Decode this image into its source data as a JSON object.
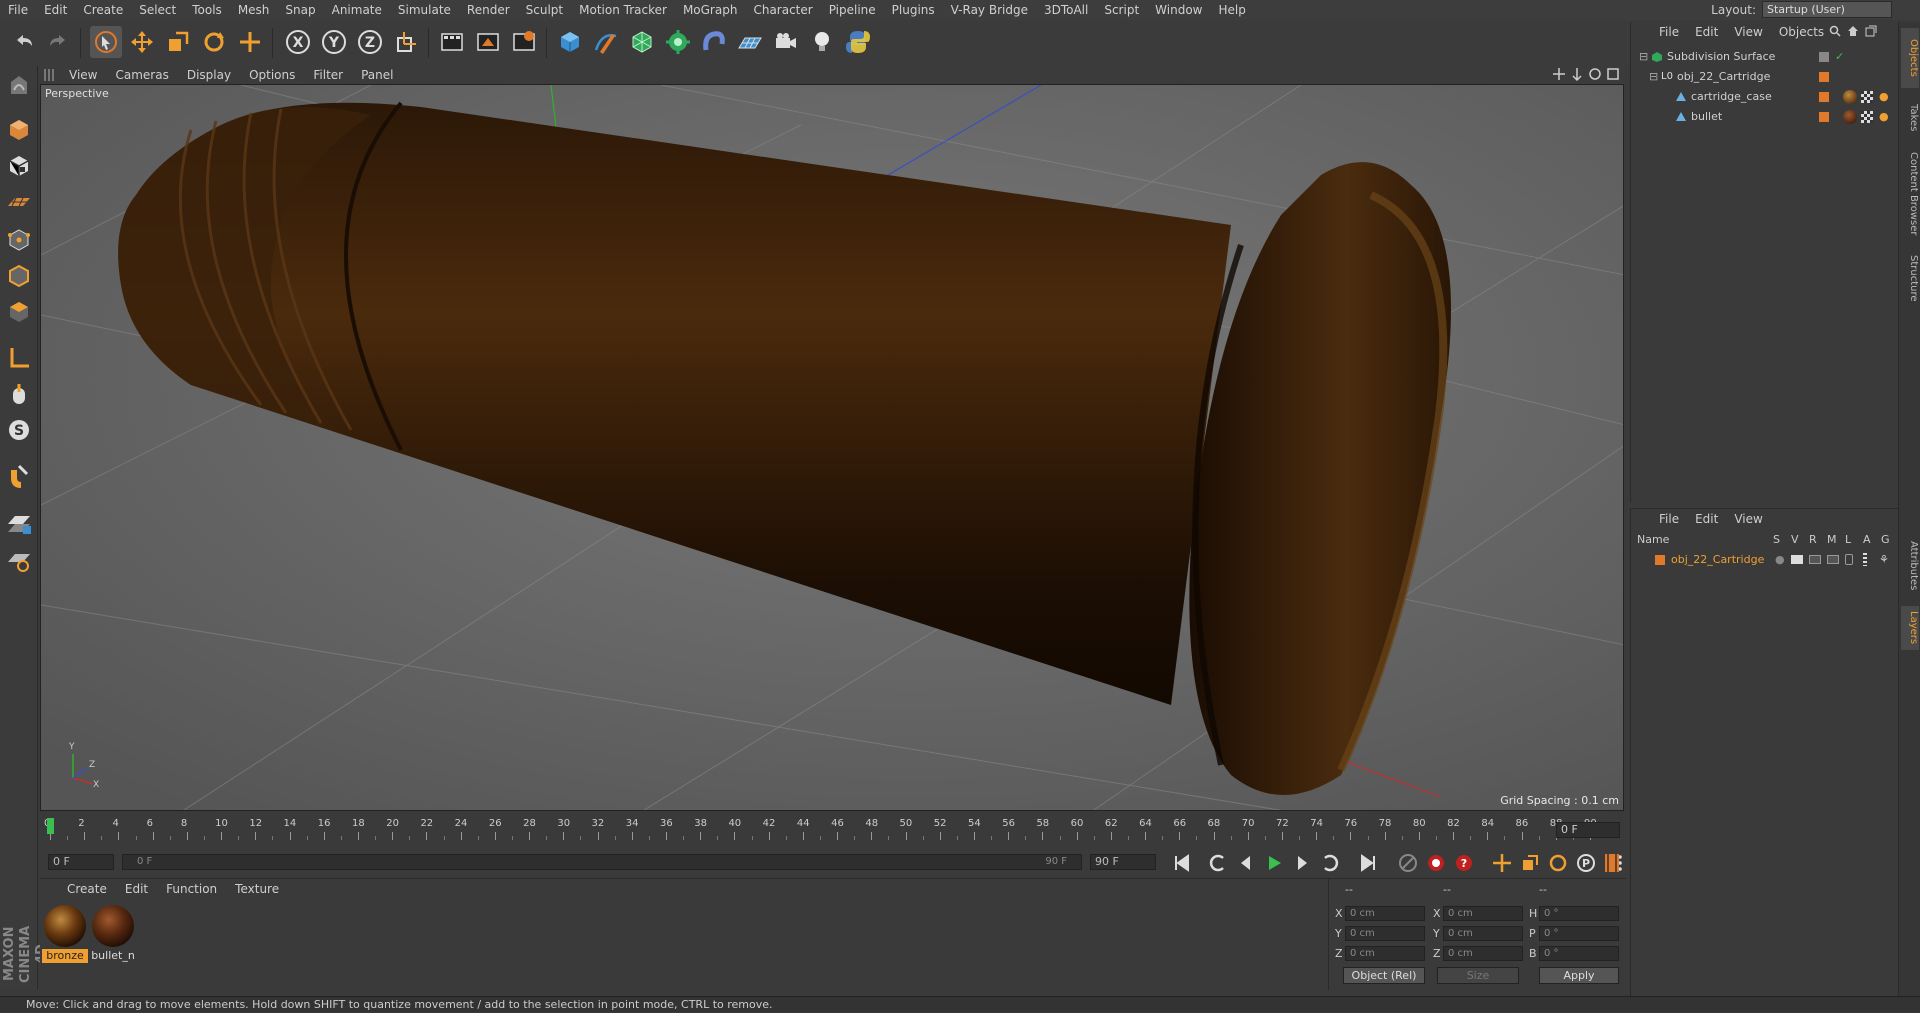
{
  "menu": [
    "File",
    "Edit",
    "Create",
    "Select",
    "Tools",
    "Mesh",
    "Snap",
    "Animate",
    "Simulate",
    "Render",
    "Sculpt",
    "Motion Tracker",
    "MoGraph",
    "Character",
    "Pipeline",
    "Plugins",
    "V-Ray Bridge",
    "3DToAll",
    "Script",
    "Window",
    "Help"
  ],
  "layout": {
    "label": "Layout:",
    "value": "Startup (User)"
  },
  "viewport": {
    "menu": [
      "View",
      "Cameras",
      "Display",
      "Options",
      "Filter",
      "Panel"
    ],
    "camera_label": "Perspective",
    "grid_spacing": "Grid Spacing : 0.1 cm",
    "axis": {
      "x": "X",
      "y": "Y",
      "z": "Z"
    }
  },
  "timeline": {
    "ticks": [
      "0",
      "2",
      "4",
      "6",
      "8",
      "10",
      "12",
      "14",
      "16",
      "18",
      "20",
      "22",
      "24",
      "26",
      "28",
      "30",
      "32",
      "34",
      "36",
      "38",
      "40",
      "42",
      "44",
      "46",
      "48",
      "50",
      "52",
      "54",
      "56",
      "58",
      "60",
      "62",
      "64",
      "66",
      "68",
      "70",
      "72",
      "74",
      "76",
      "78",
      "80",
      "82",
      "84",
      "86",
      "88",
      "90"
    ],
    "current_frame": "0 F",
    "start_field": "0 F",
    "range_start": "0 F",
    "range_end": "90 F",
    "end_field": "90 F"
  },
  "materials": {
    "menu": [
      "Create",
      "Edit",
      "Function",
      "Texture"
    ],
    "items": [
      {
        "name": "bronze",
        "selected": true
      },
      {
        "name": "bullet_n",
        "selected": false
      }
    ]
  },
  "coords": {
    "headers": [
      "--",
      "--",
      "--"
    ],
    "rows": [
      {
        "a": "X",
        "av": "0 cm",
        "b": "X",
        "bv": "0 cm",
        "c": "H",
        "cv": "0 °"
      },
      {
        "a": "Y",
        "av": "0 cm",
        "b": "Y",
        "bv": "0 cm",
        "c": "P",
        "cv": "0 °"
      },
      {
        "a": "Z",
        "av": "0 cm",
        "b": "Z",
        "bv": "0 cm",
        "c": "B",
        "cv": "0 °"
      }
    ],
    "mode_select": "Object (Rel)",
    "size_select": "Size",
    "apply": "Apply"
  },
  "objects": {
    "menu": [
      "File",
      "Edit",
      "View",
      "Objects"
    ],
    "tree": [
      {
        "name": "Subdivision Surface",
        "indent": 0
      },
      {
        "name": "obj_22_Cartridge",
        "indent": 1
      },
      {
        "name": "cartridge_case",
        "indent": 2
      },
      {
        "name": "bullet",
        "indent": 2
      }
    ]
  },
  "layers": {
    "menu": [
      "File",
      "Edit",
      "View"
    ],
    "columns": [
      "Name",
      "S",
      "V",
      "R",
      "M",
      "L",
      "A",
      "G"
    ],
    "items": [
      {
        "name": "obj_22_Cartridge",
        "color": "#e07a2a"
      }
    ]
  },
  "right_tabs": [
    "Objects",
    "Takes",
    "Content Browser",
    "Structure",
    "Attributes",
    "Layers"
  ],
  "status": "Move: Click and drag to move elements. Hold down SHIFT to quantize movement / add to the selection in point mode, CTRL to remove.",
  "brand": "MAXON CINEMA 4D",
  "colors": {
    "accent": "#e07a2a",
    "selected_text": "#f0a030",
    "bg": "#3a3a3a"
  }
}
